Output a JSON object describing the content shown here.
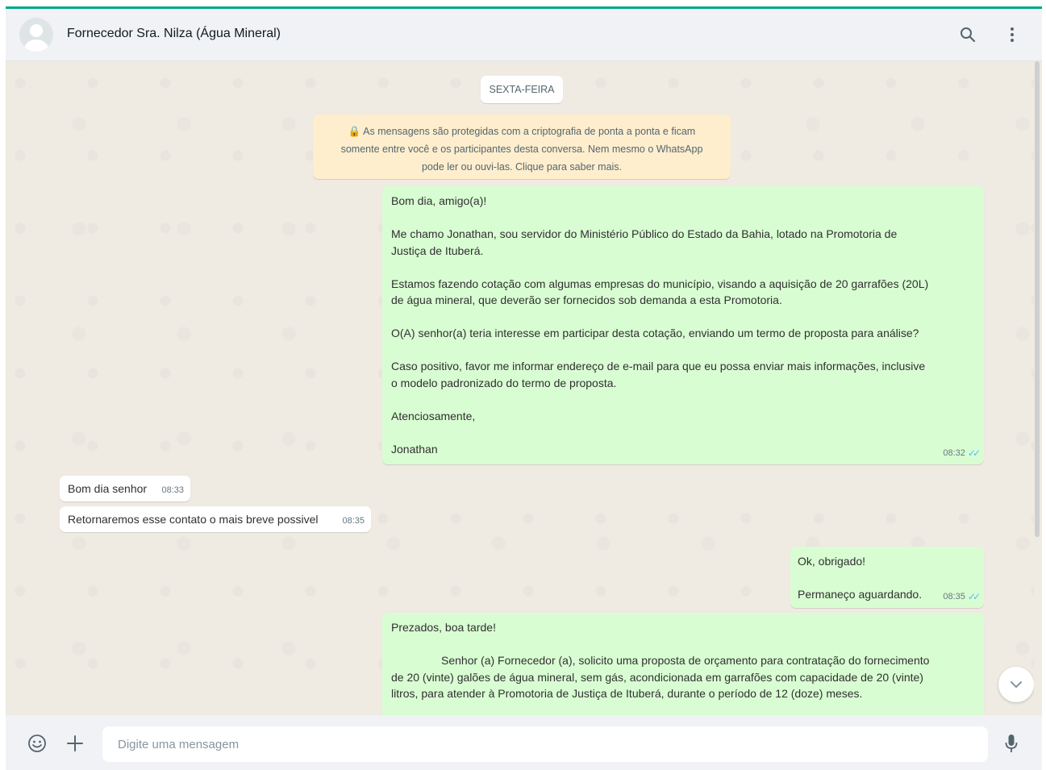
{
  "header": {
    "contact_name": "Fornecedor Sra. Nilza (Água Mineral)",
    "icons": [
      "avatar-icon",
      "search-icon",
      "menu-icon"
    ]
  },
  "chat": {
    "day_label": "SEXTA-FEIRA",
    "encryption_notice": {
      "line1": "As mensagens são protegidas com a criptografia de ponta a ponta e ficam",
      "line2": "somente entre você e os participantes desta conversa. Nem mesmo o WhatsApp",
      "line3": "pode ler ou ouvi-las. Clique para saber mais."
    },
    "messages": [
      {
        "direction": "out",
        "time": "08:32",
        "status": "read",
        "lines": [
          "Bom dia, amigo(a)!",
          "",
          "Me chamo Jonathan, sou servidor do Ministério Público do Estado da Bahia, lotado na Promotoria de",
          "Justiça de Ituberá.",
          "",
          "Estamos fazendo cotação com algumas empresas do município, visando a aquisição de 20 garrafões (20L)",
          "de água mineral, que deverão ser fornecidos sob demanda a esta Promotoria.",
          "",
          "O(A) senhor(a) teria interesse em participar desta cotação, enviando um termo de proposta para análise?",
          "",
          "Caso positivo, favor me informar endereço de  e-mail para que eu possa enviar mais informações, inclusive",
          "o modelo padronizado do termo de proposta.",
          "",
          "Atenciosamente,",
          "",
          "Jonathan"
        ]
      },
      {
        "direction": "in",
        "time": "08:33",
        "text": "Bom dia senhor"
      },
      {
        "direction": "in",
        "time": "08:35",
        "text": "Retornaremos esse contato o mais breve possivel"
      },
      {
        "direction": "out",
        "time": "08:35",
        "status": "read",
        "lines": [
          "Ok, obrigado!",
          "",
          "Permaneço aguardando."
        ]
      },
      {
        "direction": "out",
        "lines": [
          "Prezados, boa tarde!",
          "",
          "Senhor (a) Fornecedor (a), solicito uma proposta de orçamento para contratação do fornecimento",
          "de 20 (vinte) galões de água mineral, sem gás, acondicionada em garrafões com capacidade de 20 (vinte)",
          "litros, para atender à Promotoria de Justiça de Ituberá, durante o período de 12 (doze) meses."
        ]
      }
    ]
  },
  "footer": {
    "input_placeholder": "Digite uma mensagem",
    "icons": [
      "emoji-icon",
      "attach-icon",
      "microphone-icon"
    ]
  },
  "colors": {
    "accent": "#00a884",
    "outgoing_bubble": "#d9fdd3",
    "incoming_bubble": "#ffffff",
    "chat_background": "#efeae2",
    "notice_background": "#ffeecd",
    "read_ticks": "#53bdeb"
  }
}
